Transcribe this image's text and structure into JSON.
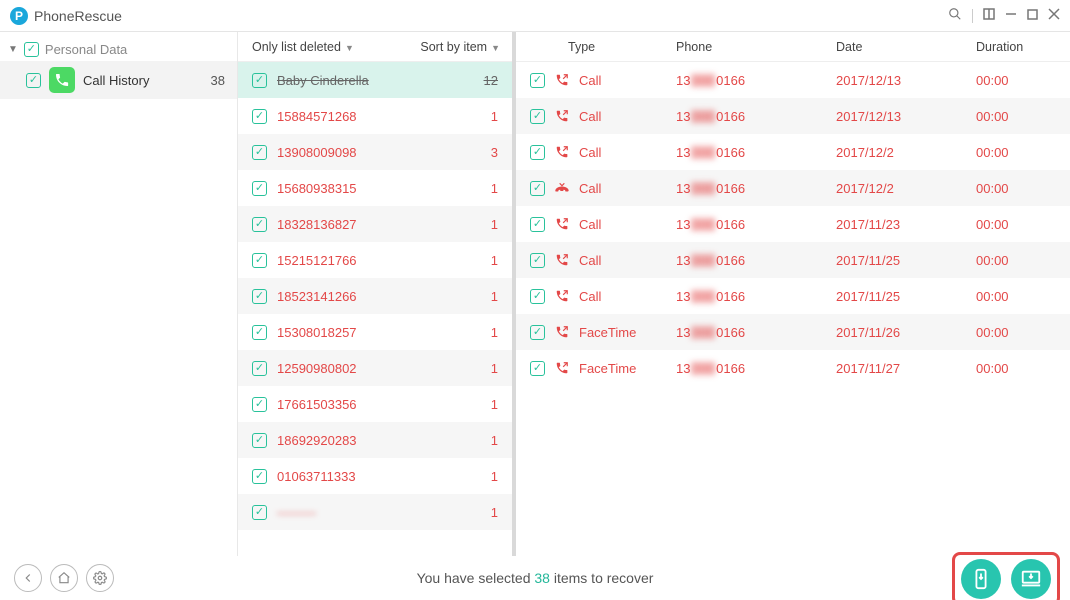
{
  "app_title": "PhoneRescue",
  "sidebar": {
    "root_label": "Personal Data",
    "items": [
      {
        "label": "Call History",
        "count": "38"
      }
    ]
  },
  "mid": {
    "header_left": "Only list deleted",
    "header_right": "Sort by item",
    "rows": [
      {
        "name": "Baby Cinderella",
        "count": "12",
        "selected": true
      },
      {
        "name": "15884571268",
        "count": "1"
      },
      {
        "name": "13908009098",
        "count": "3"
      },
      {
        "name": "15680938315",
        "count": "1"
      },
      {
        "name": "18328136827",
        "count": "1"
      },
      {
        "name": "15215121766",
        "count": "1"
      },
      {
        "name": "18523141266",
        "count": "1"
      },
      {
        "name": "15308018257",
        "count": "1"
      },
      {
        "name": "12590980802",
        "count": "1"
      },
      {
        "name": "17661503356",
        "count": "1"
      },
      {
        "name": "18692920283",
        "count": "1"
      },
      {
        "name": "01063711333",
        "count": "1"
      },
      {
        "name": "———",
        "count": "1",
        "blurred": true
      }
    ]
  },
  "right": {
    "headers": {
      "type": "Type",
      "phone": "Phone",
      "date": "Date",
      "duration": "Duration"
    },
    "phone_prefix": "13",
    "phone_suffix": "0166",
    "phone_hidden": "000",
    "rows": [
      {
        "type": "Call",
        "icon": "out",
        "date": "2017/12/13",
        "dur": "00:00"
      },
      {
        "type": "Call",
        "icon": "out",
        "date": "2017/12/13",
        "dur": "00:00"
      },
      {
        "type": "Call",
        "icon": "out",
        "date": "2017/12/2",
        "dur": "00:00"
      },
      {
        "type": "Call",
        "icon": "missed",
        "date": "2017/12/2",
        "dur": "00:00"
      },
      {
        "type": "Call",
        "icon": "out",
        "date": "2017/11/23",
        "dur": "00:00"
      },
      {
        "type": "Call",
        "icon": "out",
        "date": "2017/11/25",
        "dur": "00:00"
      },
      {
        "type": "Call",
        "icon": "out",
        "date": "2017/11/25",
        "dur": "00:00"
      },
      {
        "type": "FaceTime",
        "icon": "out",
        "date": "2017/11/26",
        "dur": "00:00"
      },
      {
        "type": "FaceTime",
        "icon": "out",
        "date": "2017/11/27",
        "dur": "00:00"
      }
    ]
  },
  "footer": {
    "prefix": "You have selected ",
    "count": "38",
    "suffix": " items to recover"
  }
}
